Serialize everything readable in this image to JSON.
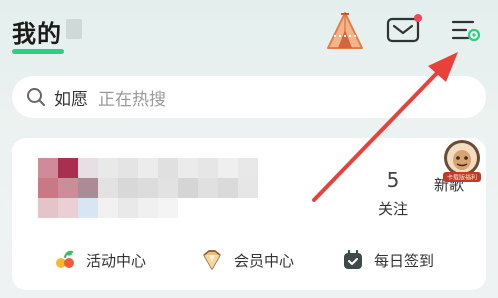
{
  "header": {
    "title": "我的",
    "icons": [
      "tent-icon",
      "mail-icon",
      "menu-settings-icon"
    ],
    "unread_dot_color": "#f0475a",
    "accent_color": "#2dcf83"
  },
  "search": {
    "keyword": "如愿",
    "hint": "正在热搜"
  },
  "profile": {
    "stats": [
      {
        "count": "5",
        "label": "关注"
      },
      {
        "count": "",
        "label": "新歌"
      }
    ],
    "badge_text": "卡载版福利"
  },
  "quick_actions": [
    {
      "label": "活动中心",
      "icon": "activity-center-icon"
    },
    {
      "label": "会员中心",
      "icon": "vip-diamond-icon"
    },
    {
      "label": "每日签到",
      "icon": "daily-signin-icon"
    }
  ]
}
